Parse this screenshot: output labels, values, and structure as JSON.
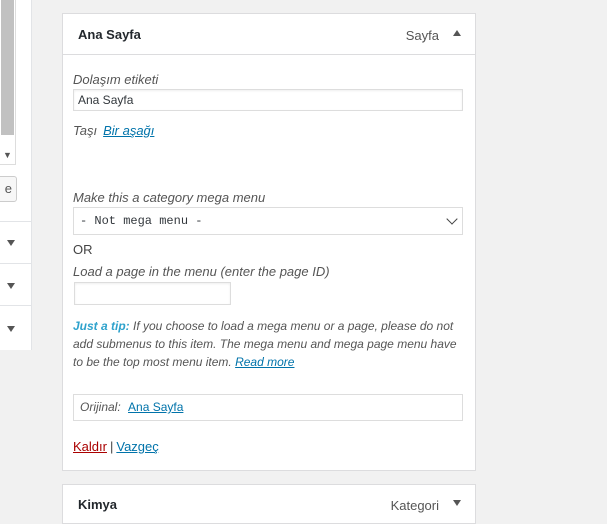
{
  "left_panel": {
    "button_label": "e"
  },
  "menu_item": {
    "title": "Ana Sayfa",
    "type": "Sayfa",
    "nav_label_label": "Dolaşım etiketi",
    "nav_label_value": "Ana Sayfa",
    "move_label": "Taşı",
    "move_down_link": "Bir aşağı",
    "mega_menu_label": "Make this a category mega menu",
    "mega_menu_selected": "- Not mega menu -",
    "or_text": "OR",
    "page_id_label": "Load a page in the menu (enter the page ID)",
    "page_id_value": "",
    "tip_label": "Just a tip:",
    "tip_text": " If you choose to load a mega menu or a page, please do not add submenus to this item. The mega menu and mega page menu have to be the top most menu item. ",
    "tip_link": "Read more",
    "original_label": "Orijinal:",
    "original_link": "Ana Sayfa",
    "remove_link": "Kaldır",
    "separator": "|",
    "cancel_link": "Vazgeç"
  },
  "menu_item_2": {
    "title": "Kimya",
    "type": "Kategori"
  }
}
